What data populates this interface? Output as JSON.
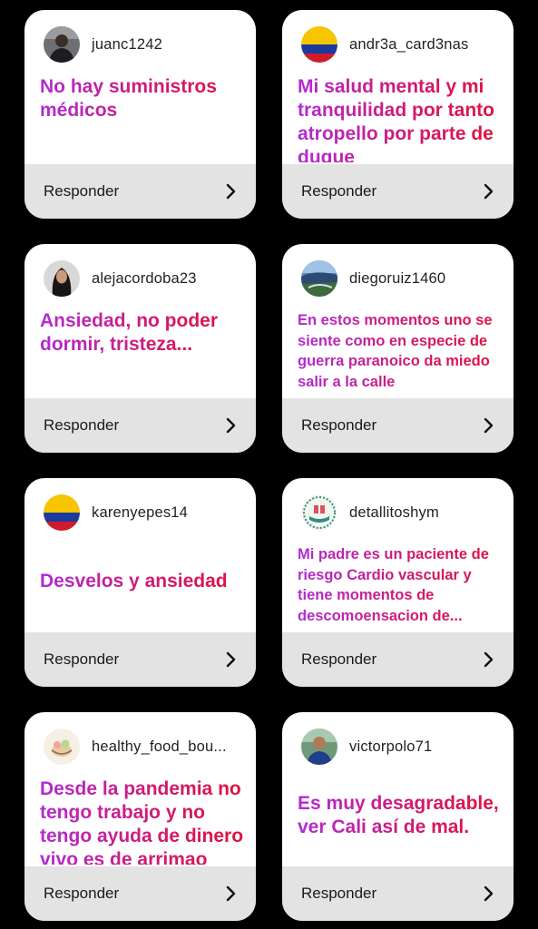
{
  "reply_label": "Responder",
  "cards": [
    {
      "username": "juanc1242",
      "message": "No hay suministros médicos",
      "avatar": "person-dark-avatar"
    },
    {
      "username": "andr3a_card3nas",
      "message": "Mi salud mental y mi tranquilidad por tanto atropello por parte de duque",
      "avatar": "colombia-flag-avatar"
    },
    {
      "username": "alejacordoba23",
      "message": "Ansiedad, no poder dormir, tristeza...",
      "avatar": "woman-avatar"
    },
    {
      "username": "diegoruiz1460",
      "message": "En estos momentos uno se siente como en especie de guerra paranoico da miedo salir a la calle",
      "avatar": "landscape-avatar"
    },
    {
      "username": "karenyepes14",
      "message": "Desvelos y ansiedad",
      "avatar": "colombia-flag-avatar"
    },
    {
      "username": "detallitoshym",
      "message": "Mi padre es un paciente de riesgo Cardio vascular y tiene momentos de descomoensacion de...",
      "avatar": "gift-logo-avatar"
    },
    {
      "username": "healthy_food_bou...",
      "message": "Desde la pandemia no tengo trabajo y no tengo ayuda de dinero vivo es de arrimao",
      "avatar": "food-logo-avatar"
    },
    {
      "username": "victorpolo71",
      "message": "Es muy desagradable, ver Cali así de mal.",
      "avatar": "man-avatar"
    }
  ],
  "colors": {
    "gradient_start": "#b12bd6",
    "gradient_end": "#e0123c",
    "reply_bg": "#e3e3e3"
  }
}
